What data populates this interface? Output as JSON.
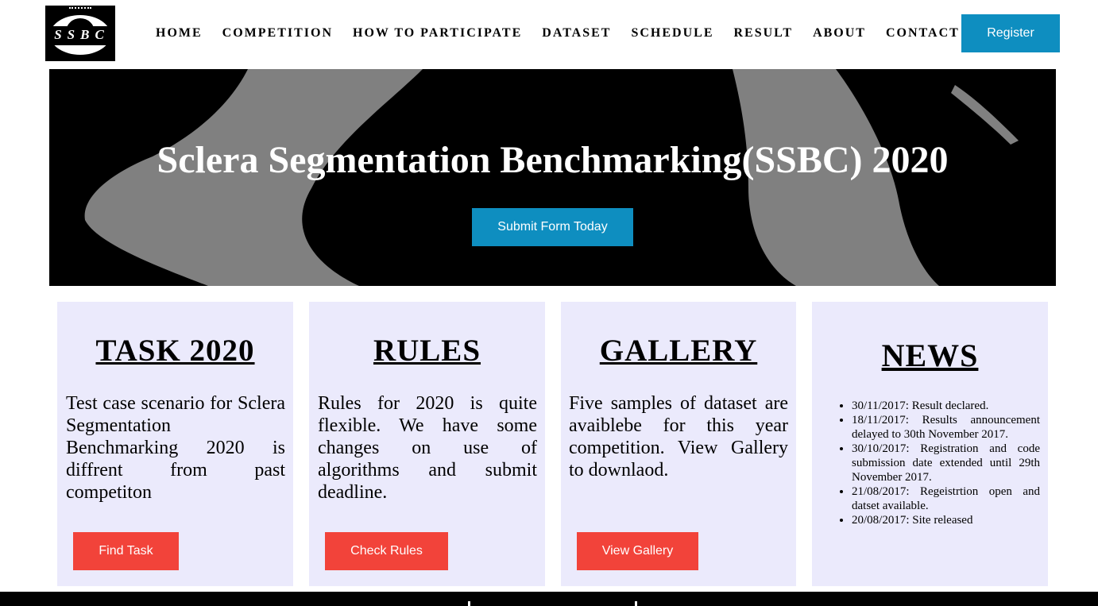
{
  "logo": {
    "text": "SSBC",
    "icon": "eye-logo"
  },
  "nav": {
    "items": [
      "HOME",
      "COMPETITION",
      "HOW TO PARTICIPATE",
      "DATASET",
      "SCHEDULE",
      "RESULT",
      "ABOUT",
      "CONTACT"
    ],
    "register_label": "Register"
  },
  "hero": {
    "title": "Sclera Segmentation Benchmarking(SSBC) 2020",
    "button_label": "Submit Form Today"
  },
  "cards": {
    "task": {
      "title": "TASK 2020",
      "text": "Test case scenario for Sclera Segmentation Benchmarking 2020 is diffrent from past competiton",
      "button": "Find Task"
    },
    "rules": {
      "title": "RULES",
      "text": "Rules for 2020 is quite flexible. We have some changes on use of algorithms and submit deadline.",
      "button": "Check Rules"
    },
    "gallery": {
      "title": "GALLERY",
      "text": "Five samples of dataset are avaiblebe for this year competition. View Gallery to downlaod.",
      "button": "View Gallery"
    },
    "news": {
      "title": "NEWS",
      "items": [
        "30/11/2017: Result declared.",
        "18/11/2017: Results announcement delayed to 30th November 2017.",
        "30/10/2017: Registration and code submission date extended until 29th November 2017.",
        "21/08/2017: Regeistrtion open and datset available.",
        "20/08/2017: Site released"
      ]
    }
  },
  "colors": {
    "accent_blue": "#0e8ec0",
    "button_red": "#f2433a",
    "card_bg": "#ebeafc",
    "hero_gray": "#808080"
  }
}
